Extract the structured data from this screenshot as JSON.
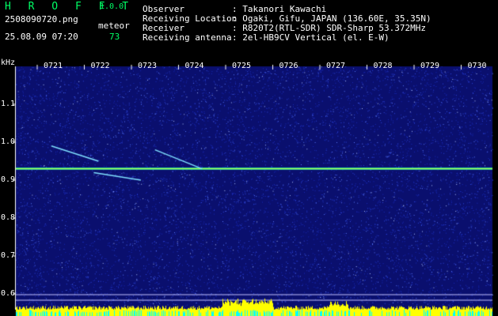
{
  "app": {
    "logo": "H R O F F T",
    "version": "1.0.0"
  },
  "image_info": {
    "filename": "2508090720.png",
    "datetime": "25.08.09 07:20",
    "meteor_label": "meteor",
    "meteor_count": "73"
  },
  "station": {
    "observer_label": "Observer",
    "observer_value": ": Takanori Kawachi",
    "location_label": "Receiving Location",
    "location_value": ": Ogaki, Gifu, JAPAN (136.60E, 35.35N)",
    "receiver_label": "Receiver",
    "receiver_value": ": R820T2(RTL-SDR) SDR-Sharp 53.372MHz",
    "antenna_label": "Receiving antenna",
    "antenna_value": ": 2el-HB9CV Vertical (el. E-W)"
  },
  "colors": {
    "header_green": "#00ff66",
    "background_blue": "#0a0f6e",
    "carrier": "#c8ff40",
    "bar_yellow": "#ffff00",
    "bar_cyan": "#00ffff"
  },
  "chart_data": {
    "type": "heatmap",
    "y_unit": "kHz",
    "x_ticks": [
      "0721",
      "0722",
      "0723",
      "0724",
      "0725",
      "0726",
      "0727",
      "0728",
      "0729",
      "0730"
    ],
    "y_ticks": [
      "1.1",
      "1.0",
      "0.9",
      "0.8",
      "0.7",
      "0.6"
    ],
    "ylim": [
      0.58,
      1.18
    ],
    "carrier_freq_khz": 0.93,
    "meteor_traces": [
      {
        "t_start": 0.3,
        "t_end": 1.3,
        "f_start": 0.99,
        "f_end": 0.95
      },
      {
        "t_start": 2.5,
        "t_end": 3.5,
        "f_start": 0.98,
        "f_end": 0.93
      },
      {
        "t_start": 1.2,
        "t_end": 2.2,
        "f_start": 0.92,
        "f_end": 0.9
      }
    ]
  }
}
